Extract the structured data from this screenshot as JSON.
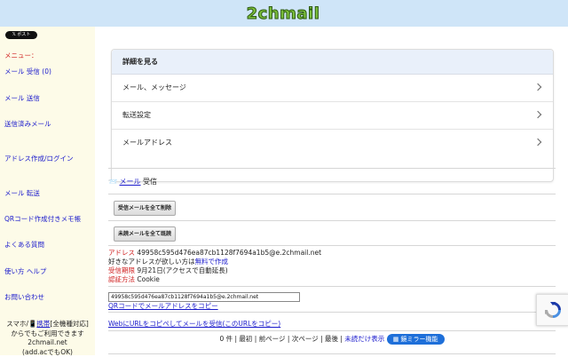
{
  "header": {
    "logo": "2chmail"
  },
  "sidebar": {
    "post_button": "𝕏 ポスト",
    "menu_label": "メニュー：",
    "items": [
      {
        "label": "メール 受信 (0)"
      },
      {
        "label": "メール 送信"
      },
      {
        "label": "送信済みメール"
      },
      {
        "label": "アドレス作成/ログイン"
      },
      {
        "label": "メール 転送"
      },
      {
        "label": "QRコード作成付きメモ帳"
      },
      {
        "label": "よくある質問"
      },
      {
        "label": "使い方 ヘルプ"
      },
      {
        "label": "お問い合わせ"
      }
    ],
    "footer": {
      "line1_prefix": "スマホ/",
      "mobile_icon": "📱",
      "mobile_link": "携帯",
      "line1_suffix": "[全機種対応]",
      "line2": "からでもご利用できます",
      "line3": "2chmail.net",
      "line4": "(add.acでもOK)"
    }
  },
  "main": {
    "details": {
      "header": "詳細を見る",
      "rows": [
        {
          "label": "メール、メッセージ"
        },
        {
          "label": "転送設定"
        },
        {
          "label": "メールアドレス"
        }
      ]
    },
    "inbox": {
      "icon": "📨",
      "mail_link": "メール",
      "title_suffix": " 受信"
    },
    "buttons": {
      "delete_all": "受信メールを全て削除",
      "mark_all_read": "未読メールを全て既読"
    },
    "info": {
      "address_label": "アドレス",
      "address_value": "49958c595d476ea87cb1128f7694a1b5@e.2chmail.net",
      "wish_prefix": "好きなアドレスが欲しい方は",
      "wish_link": "無料で作成",
      "expiry_label": "受信期限",
      "expiry_value": "9月21日(アクセスで自動延長)",
      "auth_label": "認証方法",
      "auth_value": "Cookie"
    },
    "address_input_value": "49958c595d476ea87cb1128f7694a1b5@e.2chmail.net",
    "qr_link": "QRコードでメールアドレスをコピー",
    "web_copy_link": "WebにURLをコピペしてメールを受信(このURLをコピー)",
    "pager": {
      "count": "0 件",
      "first": "最初",
      "prev": "前ページ",
      "next": "次ページ",
      "last": "最後",
      "unread_only": "未読だけ表示",
      "mirror": "鏡ミラー機能",
      "mirror_icon": "▦"
    }
  },
  "colors": {
    "header_bg": "#cfe5f8",
    "sidebar_bg": "#fdfbe8",
    "link": "#1a1acc",
    "accent_red": "#d02020",
    "mirror_button": "#1e6fd9"
  }
}
